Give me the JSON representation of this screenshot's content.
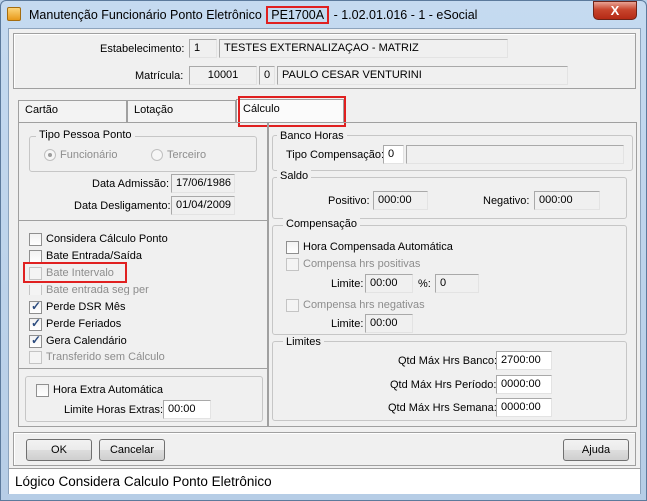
{
  "window": {
    "title_prefix": "Manutenção Funcionário Ponto Eletrônico",
    "title_code": "PE1700A",
    "title_suffix": "- 1.02.01.016 - 1 - eSocial",
    "close_label": "X"
  },
  "header": {
    "estabelecimento_label": "Estabelecimento:",
    "estabelecimento_code": "1",
    "estabelecimento_name": "TESTES EXTERNALIZAÇAO - MATRIZ",
    "matricula_label": "Matrícula:",
    "matricula_code": "10001",
    "matricula_digit": "0",
    "matricula_name": "PAULO CESAR VENTURINI"
  },
  "tabs": [
    {
      "label": "Cartão"
    },
    {
      "label": "Lotação"
    },
    {
      "label": "Cálculo"
    }
  ],
  "tipo_pessoa": {
    "title": "Tipo Pessoa Ponto",
    "option_funcionario": "Funcionário",
    "option_terceiro": "Terceiro"
  },
  "datas": {
    "admissao_label": "Data Admissão:",
    "admissao_value": "17/06/1986",
    "desligamento_label": "Data Desligamento:",
    "desligamento_value": "01/04/2009"
  },
  "checks": {
    "considera_calculo": "Considera Cálculo Ponto",
    "bate_entrada_saida": "Bate Entrada/Saída",
    "bate_intervalo": "Bate Intervalo",
    "bate_entrada_seg": "Bate entrada seg per",
    "perde_dsr": "Perde DSR Mês",
    "perde_feriados": "Perde Feriados",
    "gera_calendario": "Gera Calendário",
    "transferido": "Transferido sem Cálculo"
  },
  "hora_extra": {
    "check_label": "Hora Extra Automática",
    "limite_label": "Limite Horas Extras:",
    "limite_value": "00:00"
  },
  "banco_horas": {
    "title": "Banco Horas",
    "tipo_label": "Tipo Compensação:",
    "tipo_value": "0",
    "tipo_desc": ""
  },
  "saldo": {
    "title": "Saldo",
    "positivo_label": "Positivo:",
    "positivo_value": "000:00",
    "negativo_label": "Negativo:",
    "negativo_value": "000:00"
  },
  "compensacao": {
    "title": "Compensação",
    "hora_compensada": "Hora Compensada Automática",
    "compensa_positivas": "Compensa hrs positivas",
    "limite_label": "Limite:",
    "limite_value": "00:00",
    "percent_label": "%:",
    "percent_value": "0",
    "compensa_negativas": "Compensa hrs negativas",
    "limite2_label": "Limite:",
    "limite2_value": "00:00"
  },
  "limites": {
    "title": "Limites",
    "banco_label": "Qtd Máx Hrs Banco:",
    "banco_value": "2700:00",
    "periodo_label": "Qtd Máx Hrs Período:",
    "periodo_value": "0000:00",
    "semana_label": "Qtd Máx Hrs Semana:",
    "semana_value": "0000:00"
  },
  "buttons": {
    "ok": "OK",
    "cancelar": "Cancelar",
    "ajuda": "Ajuda"
  },
  "status": {
    "text": "Lógico Considera Calculo Ponto Eletrônico"
  }
}
